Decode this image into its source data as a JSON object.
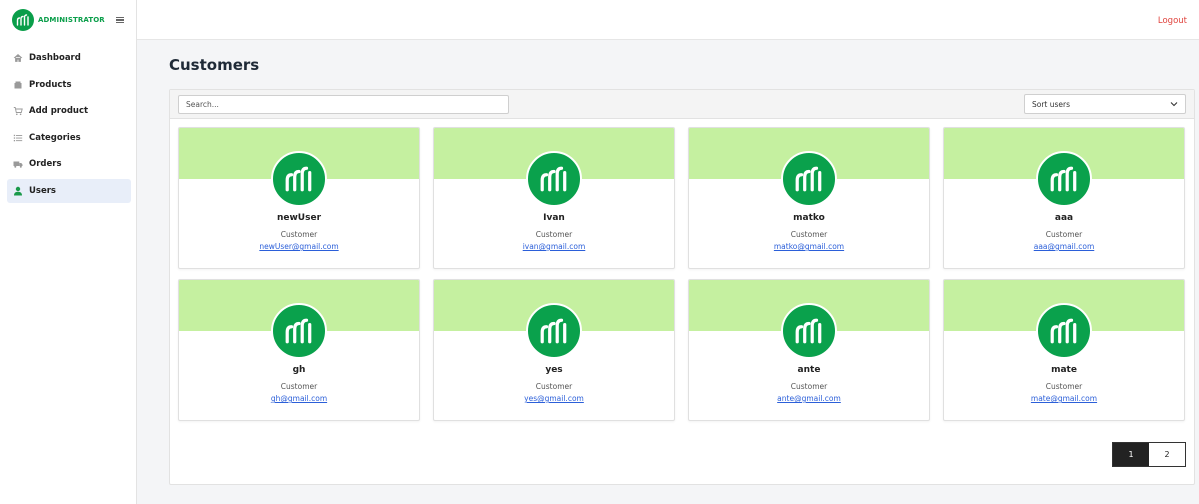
{
  "brand": {
    "name": "ADMINISTRATOR",
    "accent": "#0a9e4a"
  },
  "sidebar": {
    "items": [
      {
        "label": "Dashboard",
        "icon": "home-icon"
      },
      {
        "label": "Products",
        "icon": "box-icon"
      },
      {
        "label": "Add product",
        "icon": "cart-icon"
      },
      {
        "label": "Categories",
        "icon": "list-icon"
      },
      {
        "label": "Orders",
        "icon": "truck-icon"
      },
      {
        "label": "Users",
        "icon": "user-icon",
        "active": true
      }
    ]
  },
  "topbar": {
    "logout_label": "Logout",
    "logout_color": "#e0443e"
  },
  "main": {
    "title": "Customers",
    "search": {
      "placeholder": "Search...",
      "value": ""
    },
    "sort": {
      "selected": "Sort users"
    },
    "users": [
      {
        "name": "newUser",
        "role": "Customer",
        "email": "newUser@gmail.com"
      },
      {
        "name": "Ivan",
        "role": "Customer",
        "email": "ivan@gmail.com"
      },
      {
        "name": "matko",
        "role": "Customer",
        "email": "matko@gmail.com"
      },
      {
        "name": "aaa",
        "role": "Customer",
        "email": "aaa@gmail.com"
      },
      {
        "name": "gh",
        "role": "Customer",
        "email": "gh@gmail.com"
      },
      {
        "name": "yes",
        "role": "Customer",
        "email": "yes@gmail.com"
      },
      {
        "name": "ante",
        "role": "Customer",
        "email": "ante@gmail.com"
      },
      {
        "name": "mate",
        "role": "Customer",
        "email": "mate@gmail.com"
      }
    ],
    "card_banner_color": "#c5f0a0",
    "pagination": {
      "pages": [
        "1",
        "2"
      ],
      "current": "1"
    }
  }
}
